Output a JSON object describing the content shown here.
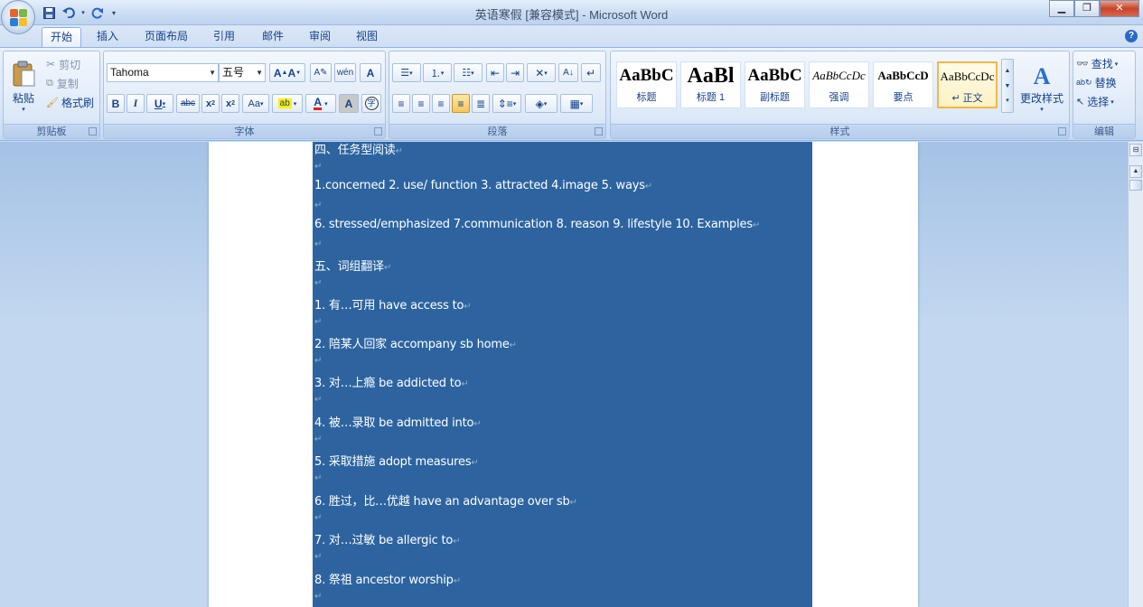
{
  "window": {
    "title": "英语寒假 [兼容模式] - Microsoft Word"
  },
  "qat": {
    "items": [
      "save-icon",
      "undo-icon",
      "redo-icon",
      "customize-icon"
    ]
  },
  "tabs": [
    "开始",
    "插入",
    "页面布局",
    "引用",
    "邮件",
    "审阅",
    "视图"
  ],
  "ribbon": {
    "clipboard": {
      "label": "剪贴板",
      "paste": "粘贴",
      "cut": "剪切",
      "copy": "复制",
      "format_painter": "格式刷"
    },
    "font": {
      "label": "字体",
      "font_name": "Tahoma",
      "font_size": "五号"
    },
    "paragraph": {
      "label": "段落"
    },
    "styles": {
      "label": "样式",
      "cards": [
        {
          "sample": "AaBbC",
          "name": "标题"
        },
        {
          "sample": "AaBl",
          "name": "标题 1"
        },
        {
          "sample": "AaBbC",
          "name": "副标题"
        },
        {
          "sample": "AaBbCcDc",
          "name": "强调"
        },
        {
          "sample": "AaBbCcD",
          "name": "要点"
        },
        {
          "sample": "AaBbCcDc",
          "name": "↵ 正文"
        }
      ],
      "change_styles": "更改样式"
    },
    "editing": {
      "label": "编辑",
      "find": "查找",
      "replace": "替换",
      "select": "选择"
    }
  },
  "document": {
    "lines": [
      "四、任务型阅读",
      "1.concerned 2. use/ function 3. attracted 4.image 5. ways",
      "6. stressed/emphasized  7.communication 8. reason 9. lifestyle 10. Examples",
      "五、词组翻译",
      "1. 有…可用  have access  to",
      "2. 陪某人回家 accompany sb home",
      "3. 对…上瘾 be addicted to",
      "4. 被…录取 be admitted into",
      "5. 采取措施 adopt measures",
      "6. 胜过，比…优越  have an advantage over sb",
      "7. 对…过敏  be allergic to",
      "8. 祭祖  ancestor worship"
    ]
  },
  "colors": {
    "selection": "#2d64a0",
    "ribbon_bg": "#dbe7f6",
    "workspace_bg": "#c3d8f0"
  }
}
